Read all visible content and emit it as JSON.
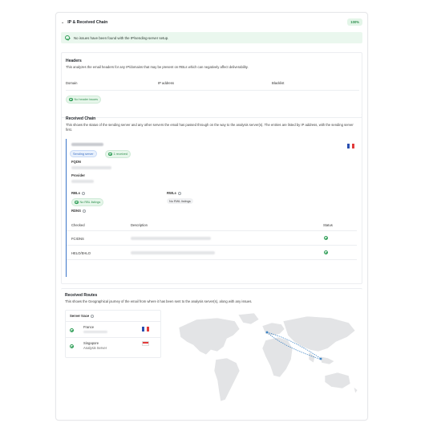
{
  "header": {
    "title": "IP & Received Chain",
    "score": "100%"
  },
  "banner": {
    "text": "No issues have been found with the IP/sending-server setup."
  },
  "headers_section": {
    "title": "Headers",
    "description": "This analyzes the email headers for any IP/domains that may be present on RBLs which can negatively affect deliverability.",
    "col_domain": "Domain",
    "col_ip": "IP address",
    "col_blacklist": "Blacklist",
    "status_pill": "No header issues"
  },
  "received_chain": {
    "title": "Received Chain",
    "description": "This shows the status of the sending server and any other servers the email has passed through on the way to the analysis server(s). The entries are listed by IP address, with the sending server first.",
    "server": {
      "badge_sending": "Sending server",
      "badge_received": "1 received",
      "fqdn_label": "FQDN",
      "provider_label": "Provider",
      "rbls_label": "RBLs",
      "rbls_pill": "No RBL listings",
      "rwls_label": "RWLs",
      "rwls_pill": "No RWL listings",
      "rdns_label": "RDNS",
      "table": {
        "col_checked": "Checked",
        "col_description": "Description",
        "col_status": "Status",
        "rows": [
          {
            "checked": "FCrDNS"
          },
          {
            "checked": "HELO/EHLO"
          }
        ]
      }
    }
  },
  "received_routes": {
    "title": "Received Routes",
    "description": "This shows the Geographical journey of the email from where it has been sent to the analysis server(s), along with any issues.",
    "server_trace_label": "Server trace",
    "entries": [
      {
        "country": "France",
        "sub": ""
      },
      {
        "country": "Singapore",
        "sub": "Analysis Server"
      }
    ]
  },
  "icons": {
    "collapse": "chevron-down-icon",
    "check": "check-circle-icon",
    "info": "info-icon"
  },
  "colors": {
    "accent_green": "#2f9e57",
    "route_blue": "#3b82c4",
    "chain_blue": "#3a74c9"
  }
}
